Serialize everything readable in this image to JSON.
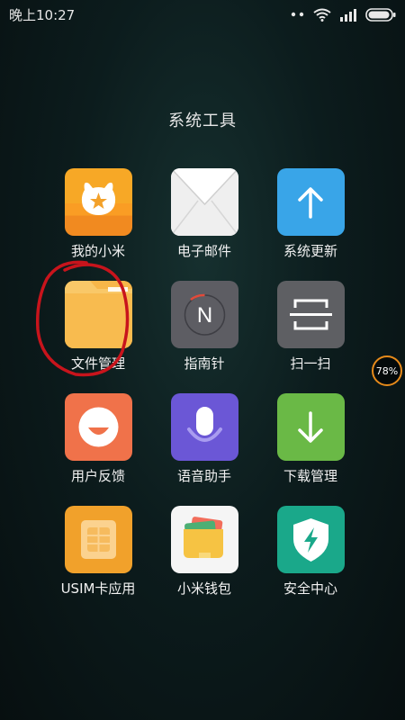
{
  "status_bar": {
    "time": "晚上10:27",
    "icons": [
      "dots-icon",
      "wifi-icon",
      "signal-icon",
      "battery-icon"
    ]
  },
  "folder": {
    "title": "系统工具"
  },
  "apps": [
    {
      "label": "我的小米",
      "icon": "mi-bunny-icon",
      "color": "#f9a228"
    },
    {
      "label": "电子邮件",
      "icon": "envelope-icon",
      "color": "#eeeeee"
    },
    {
      "label": "系统更新",
      "icon": "arrow-up-icon",
      "color": "#39a5e8"
    },
    {
      "label": "文件管理",
      "icon": "folder-icon",
      "color": "#f8b84a"
    },
    {
      "label": "指南针",
      "icon": "compass-icon",
      "color": "#5d5d63"
    },
    {
      "label": "扫一扫",
      "icon": "scan-icon",
      "color": "#5e5f63"
    },
    {
      "label": "用户反馈",
      "icon": "smile-icon",
      "color": "#f0724a"
    },
    {
      "label": "语音助手",
      "icon": "microphone-icon",
      "color": "#6b57d6"
    },
    {
      "label": "下载管理",
      "icon": "arrow-down-icon",
      "color": "#6ab946"
    },
    {
      "label": "USIM卡应用",
      "icon": "sim-card-icon",
      "color": "#f1a12b"
    },
    {
      "label": "小米钱包",
      "icon": "wallet-icon",
      "color": "#f5f5f5"
    },
    {
      "label": "安全中心",
      "icon": "shield-icon",
      "color": "#1aa88a"
    }
  ],
  "compass": {
    "letter": "N"
  },
  "floating_battery": {
    "text": "78%"
  },
  "annotation": {
    "color": "#c8141c"
  }
}
